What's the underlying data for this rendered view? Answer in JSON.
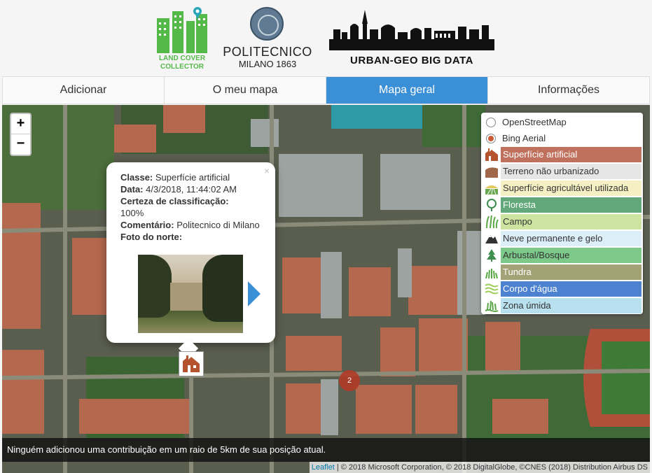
{
  "header": {
    "lcc_logo_text": "LAND COVER COLLECTOR",
    "polimi_name": "POLITECNICO",
    "polimi_sub": "MILANO 1863",
    "urban_text": "URBAN-GEO BIG DATA"
  },
  "nav": {
    "tabs": [
      {
        "label": "Adicionar",
        "active": false
      },
      {
        "label": "O meu mapa",
        "active": false
      },
      {
        "label": "Mapa geral",
        "active": true
      },
      {
        "label": "Informações",
        "active": false
      }
    ]
  },
  "map": {
    "zoom_in": "+",
    "zoom_out": "−",
    "popup": {
      "close": "×",
      "classe_label": "Classe:",
      "classe_value": "Superfície artificial",
      "data_label": "Data:",
      "data_value": "4/3/2018, 11:44:02 AM",
      "certeza_label": "Certeza de classificação:",
      "certeza_value": "100%",
      "comentario_label": "Comentário:",
      "comentario_value": "Politecnico di Milano",
      "foto_label": "Foto do norte:"
    },
    "cluster_count": "2",
    "layers": {
      "base": [
        {
          "label": "OpenStreetMap",
          "checked": false
        },
        {
          "label": "Bing Aerial",
          "checked": true
        }
      ],
      "overlays": [
        {
          "label": "Superfície artificial",
          "color": "#c0715d",
          "icon": "building-icon"
        },
        {
          "label": "Terreno não urbanizado",
          "color": "#e6e6e6",
          "icon": "bare-land-icon"
        },
        {
          "label": "Superfície agricultável utilizada",
          "color": "#f5f0c4",
          "icon": "field-icon"
        },
        {
          "label": "Floresta",
          "color": "#62a87a",
          "icon": "tree-icon"
        },
        {
          "label": "Campo",
          "color": "#cde3a0",
          "icon": "grass-icon"
        },
        {
          "label": "Neve permanente e gelo",
          "color": "#dceef8",
          "icon": "snow-icon"
        },
        {
          "label": "Arbustal/Bosque",
          "color": "#7cc98a",
          "icon": "shrub-icon"
        },
        {
          "label": "Tundra",
          "color": "#a3a277",
          "icon": "tundra-icon"
        },
        {
          "label": "Corpo d'água",
          "color": "#4c82cf",
          "icon": "water-icon"
        },
        {
          "label": "Zona úmida",
          "color": "#b9e0ef",
          "icon": "wetland-icon"
        }
      ]
    },
    "status_message": "Ninguém adicionou uma contribuição em um raio de 5km de sua posição atual.",
    "attribution_link": "Leaflet",
    "attribution_text": " | © 2018 Microsoft Corporation, © 2018 DigitalGlobe, ©CNES (2018) Distribution Airbus DS"
  }
}
